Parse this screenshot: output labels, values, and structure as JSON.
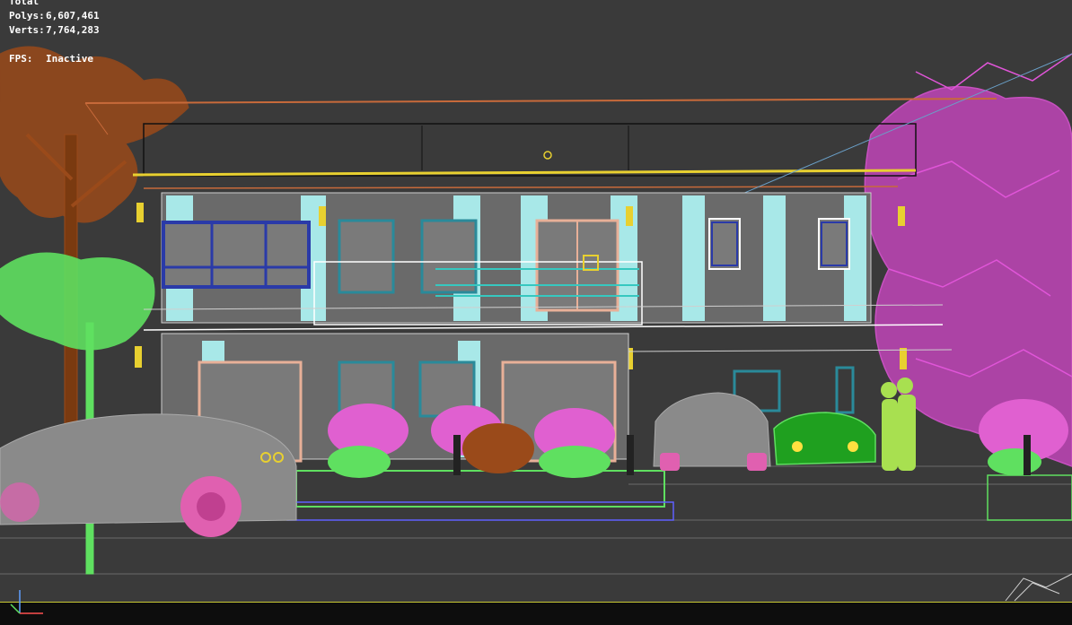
{
  "viewport": {
    "stats": {
      "total_label": "Total",
      "polys_label": "Polys:",
      "polys_value": "6,607,461",
      "verts_label": "Verts:",
      "verts_value": "7,764,283",
      "fps_label": "FPS:",
      "fps_value": "Inactive"
    },
    "colors": {
      "background": "#3a3a3a",
      "tree_left": "#9a4a1a",
      "tree_right": "#e055d8",
      "shrub_green": "#5fe060",
      "house_wire": "#ffffff",
      "window_frame_blue": "#2a3aa8",
      "window_frame_teal": "#2a8a9a",
      "curtain": "#a8e8e8",
      "car_gray": "#8a8a8a",
      "car_green": "#1fa01f",
      "wheel_pink": "#e060b0",
      "person_green": "#a8e050",
      "roof_yellow": "#e8d030",
      "roof_orange": "#c86a3a",
      "bottom_line": "#c8c832"
    },
    "icons": [
      "axis-gizmo-icon"
    ]
  }
}
